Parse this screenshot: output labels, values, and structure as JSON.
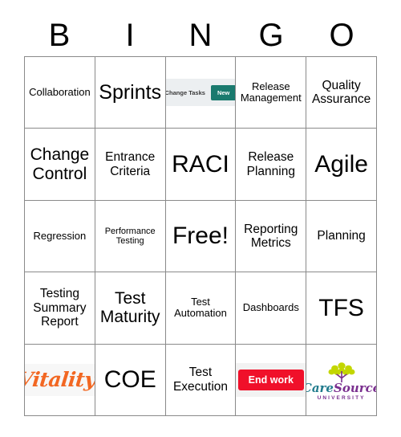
{
  "card": {
    "header_letters": [
      "B",
      "I",
      "N",
      "G",
      "O"
    ],
    "rows": [
      [
        {
          "type": "text",
          "label": "Collaboration",
          "size": "sm"
        },
        {
          "type": "text",
          "label": "Sprints",
          "size": "xl"
        },
        {
          "type": "image",
          "image": "change-tasks-screenshot",
          "ct_label": "Change Tasks",
          "ct_button": "New",
          "button_color": "#1a7a6e"
        },
        {
          "type": "text",
          "label": "Release Management",
          "size": "sm"
        },
        {
          "type": "text",
          "label": "Quality Assurance",
          "size": "md"
        }
      ],
      [
        {
          "type": "text",
          "label": "Change Control",
          "size": "lg"
        },
        {
          "type": "text",
          "label": "Entrance Criteria",
          "size": "md"
        },
        {
          "type": "text",
          "label": "RACI",
          "size": "xxl"
        },
        {
          "type": "text",
          "label": "Release Planning",
          "size": "md"
        },
        {
          "type": "text",
          "label": "Agile",
          "size": "xxl"
        }
      ],
      [
        {
          "type": "text",
          "label": "Regression",
          "size": "sm"
        },
        {
          "type": "text",
          "label": "Performance Testing",
          "size": "xs"
        },
        {
          "type": "text",
          "label": "Free!",
          "size": "xxl"
        },
        {
          "type": "text",
          "label": "Reporting Metrics",
          "size": "md"
        },
        {
          "type": "text",
          "label": "Planning",
          "size": "md"
        }
      ],
      [
        {
          "type": "text",
          "label": "Testing Summary Report",
          "size": "md"
        },
        {
          "type": "text",
          "label": "Test Maturity",
          "size": "lg"
        },
        {
          "type": "text",
          "label": "Test Automation",
          "size": "sm"
        },
        {
          "type": "text",
          "label": "Dashboards",
          "size": "sm"
        },
        {
          "type": "text",
          "label": "TFS",
          "size": "xxl"
        }
      ],
      [
        {
          "type": "image",
          "image": "vitality-logo",
          "logo_text": "Vitality",
          "logo_mark": "®",
          "logo_color": "#f26722"
        },
        {
          "type": "text",
          "label": "COE",
          "size": "xxl"
        },
        {
          "type": "text",
          "label": "Test Execution",
          "size": "md"
        },
        {
          "type": "image",
          "image": "end-work-button",
          "button_label": "End work",
          "button_color": "#f0102a"
        },
        {
          "type": "image",
          "image": "caresource-university-logo",
          "brand_care": "Care",
          "brand_source": "Source",
          "brand_sub": "UNIVERSITY",
          "leaf_color": "#c3d600",
          "trunk_color": "#7a2f8f",
          "care_color": "#1f7a8c",
          "source_color": "#7a2f8f"
        }
      ]
    ]
  },
  "style": {
    "border_color": "#8a8a8a",
    "background": "#ffffff",
    "text_color": "#000000"
  }
}
